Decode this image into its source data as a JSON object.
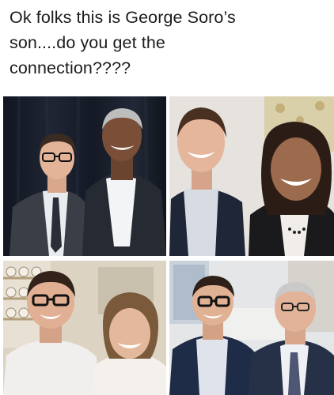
{
  "post": {
    "caption": "Ok folks this is George Soro’s\nson....do you get the\nconnection????"
  },
  "colors": {
    "background": "#ffffff",
    "caption_text": "#1c1c1c"
  },
  "photos": [
    {
      "id": "photo-1",
      "description_icon": "two-men-dark-curtain-photo"
    },
    {
      "id": "photo-2",
      "description_icon": "man-and-woman-photo"
    },
    {
      "id": "photo-3",
      "description_icon": "man-and-woman-kitchen-photo"
    },
    {
      "id": "photo-4",
      "description_icon": "two-men-office-photo"
    }
  ]
}
